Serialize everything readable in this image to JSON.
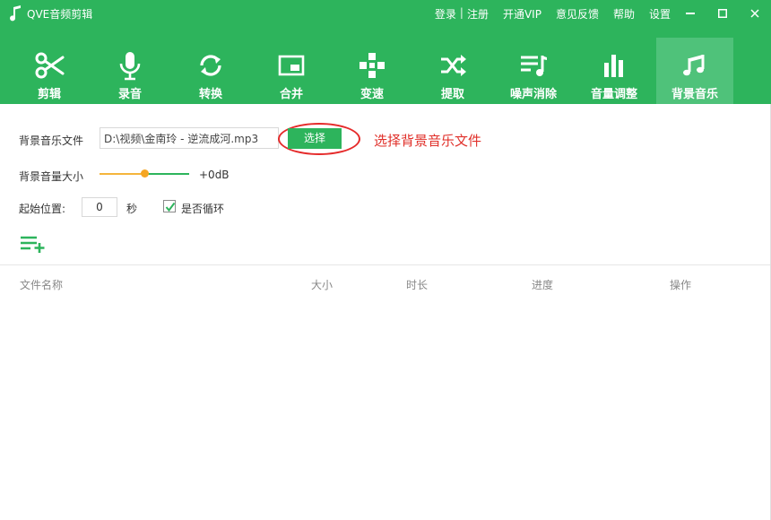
{
  "app": {
    "title": "QVE音频剪辑",
    "accent_color": "#2db45c"
  },
  "top_links": {
    "login": "登录",
    "separator": "|",
    "register": "注册",
    "vip": "开通VIP",
    "feedback": "意见反馈",
    "help": "帮助",
    "settings": "设置"
  },
  "window_buttons": [
    "minimize-icon",
    "maximize-icon",
    "close-icon"
  ],
  "toolbar": {
    "items": [
      {
        "label": "剪辑",
        "icon": "scissors-icon"
      },
      {
        "label": "录音",
        "icon": "microphone-icon"
      },
      {
        "label": "转换",
        "icon": "convert-icon"
      },
      {
        "label": "合并",
        "icon": "merge-icon"
      },
      {
        "label": "变速",
        "icon": "speed-icon"
      },
      {
        "label": "提取",
        "icon": "extract-icon"
      },
      {
        "label": "噪声消除",
        "icon": "noise-removal-icon"
      },
      {
        "label": "音量调整",
        "icon": "volume-adjust-icon"
      },
      {
        "label": "背景音乐",
        "icon": "music-note-icon"
      }
    ],
    "active_index": 8
  },
  "form": {
    "bg_file_label": "背景音乐文件",
    "bg_file_value": "D:\\视频\\金南玲 - 逆流成河.mp3",
    "choose_label": "选择",
    "annotation": "选择背景音乐文件",
    "volume_label": "背景音量大小",
    "volume_fraction": 0.5,
    "volume_value": "+0dB",
    "start_label": "起始位置:",
    "start_value": "0",
    "seconds_unit": "秒",
    "loop_label": "是否循环",
    "loop_checked": true
  },
  "table": {
    "columns": [
      "文件名称",
      "大小",
      "时长",
      "进度",
      "操作"
    ],
    "rows": []
  }
}
